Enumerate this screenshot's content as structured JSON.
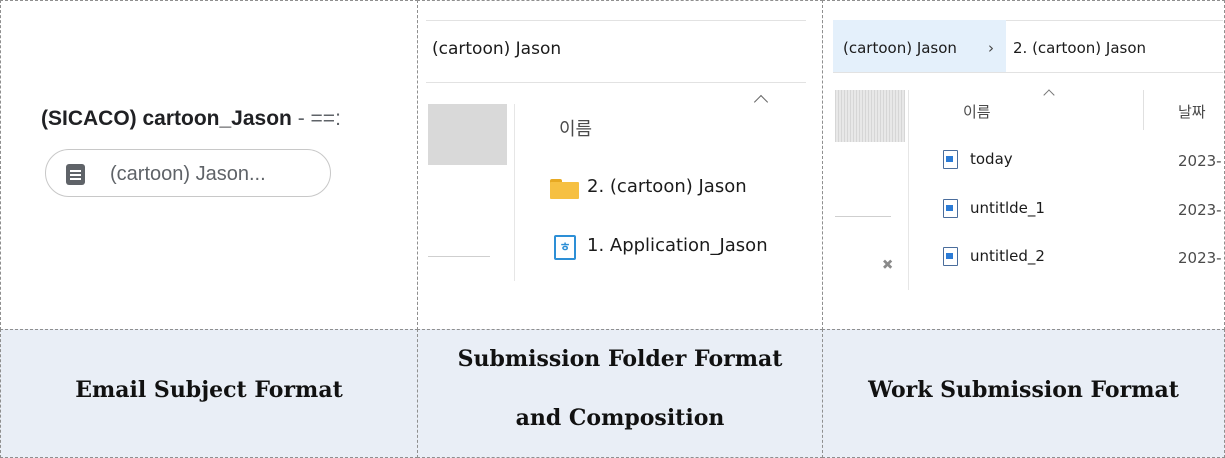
{
  "email_panel": {
    "subject_bold": "(SICACO) cartoon_Jason",
    "subject_rest": " - ==:",
    "attachment_chip": "(cartoon) Jason..."
  },
  "folder_panel": {
    "path": "(cartoon)  Jason",
    "header_name": "이름",
    "items": [
      {
        "label": "2. (cartoon) Jason",
        "icon": "folder-icon"
      },
      {
        "label": "1. Application_Jason",
        "icon": "hwp-file-icon",
        "icon_glyph": "ㅎ"
      }
    ]
  },
  "work_panel": {
    "breadcrumb_1": "(cartoon)  Jason",
    "breadcrumb_sep": "›",
    "breadcrumb_2": "2. (cartoon) Jason",
    "header_name": "이름",
    "header_date": "날짜",
    "files": [
      {
        "name": "today",
        "date": "2023-"
      },
      {
        "name": "untitlde_1",
        "date": "2023-"
      },
      {
        "name": "untitled_2",
        "date": "2023-"
      }
    ]
  },
  "captions": {
    "email": "Email Subject Format",
    "folder_line1": "Submission Folder Format",
    "folder_line2": "and Composition",
    "work": "Work Submission Format"
  }
}
